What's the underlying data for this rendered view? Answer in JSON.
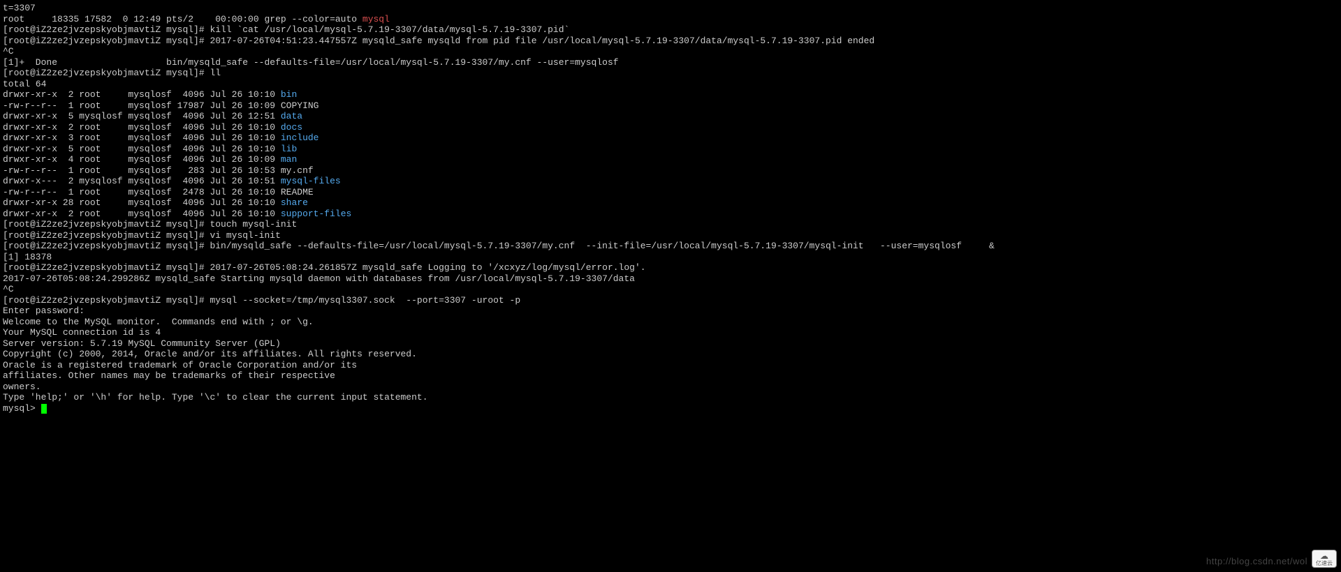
{
  "lines": [
    {
      "segments": [
        {
          "t": "t=3307",
          "c": "white"
        }
      ]
    },
    {
      "segments": [
        {
          "t": "root     18335 17582  0 12:49 pts/2    00:00:00 grep --color=auto ",
          "c": "white"
        },
        {
          "t": "mysql",
          "c": "red"
        }
      ]
    },
    {
      "segments": [
        {
          "t": "[root@iZ2ze2jvzepskyobjmavtiZ mysql]# kill `cat /usr/local/mysql-5.7.19-3307/data/mysql-5.7.19-3307.pid`",
          "c": "white"
        }
      ]
    },
    {
      "segments": [
        {
          "t": "[root@iZ2ze2jvzepskyobjmavtiZ mysql]# 2017-07-26T04:51:23.447557Z mysqld_safe mysqld from pid file /usr/local/mysql-5.7.19-3307/data/mysql-5.7.19-3307.pid ended",
          "c": "white"
        }
      ]
    },
    {
      "segments": [
        {
          "t": "^C",
          "c": "white"
        }
      ]
    },
    {
      "segments": [
        {
          "t": "[1]+  Done                    bin/mysqld_safe --defaults-file=/usr/local/mysql-5.7.19-3307/my.cnf --user=mysqlosf",
          "c": "white"
        }
      ]
    },
    {
      "segments": [
        {
          "t": "[root@iZ2ze2jvzepskyobjmavtiZ mysql]# ll",
          "c": "white"
        }
      ]
    },
    {
      "segments": [
        {
          "t": "total 64",
          "c": "white"
        }
      ]
    },
    {
      "segments": [
        {
          "t": "drwxr-xr-x  2 root     mysqlosf  4096 Jul 26 10:10 ",
          "c": "white"
        },
        {
          "t": "bin",
          "c": "cyan"
        }
      ]
    },
    {
      "segments": [
        {
          "t": "-rw-r--r--  1 root     mysqlosf 17987 Jul 26 10:09 COPYING",
          "c": "white"
        }
      ]
    },
    {
      "segments": [
        {
          "t": "drwxr-xr-x  5 mysqlosf mysqlosf  4096 Jul 26 12:51 ",
          "c": "white"
        },
        {
          "t": "data",
          "c": "cyan"
        }
      ]
    },
    {
      "segments": [
        {
          "t": "drwxr-xr-x  2 root     mysqlosf  4096 Jul 26 10:10 ",
          "c": "white"
        },
        {
          "t": "docs",
          "c": "cyan"
        }
      ]
    },
    {
      "segments": [
        {
          "t": "drwxr-xr-x  3 root     mysqlosf  4096 Jul 26 10:10 ",
          "c": "white"
        },
        {
          "t": "include",
          "c": "cyan"
        }
      ]
    },
    {
      "segments": [
        {
          "t": "drwxr-xr-x  5 root     mysqlosf  4096 Jul 26 10:10 ",
          "c": "white"
        },
        {
          "t": "lib",
          "c": "cyan"
        }
      ]
    },
    {
      "segments": [
        {
          "t": "drwxr-xr-x  4 root     mysqlosf  4096 Jul 26 10:09 ",
          "c": "white"
        },
        {
          "t": "man",
          "c": "cyan"
        }
      ]
    },
    {
      "segments": [
        {
          "t": "-rw-r--r--  1 root     mysqlosf   283 Jul 26 10:53 my.cnf",
          "c": "white"
        }
      ]
    },
    {
      "segments": [
        {
          "t": "drwxr-x---  2 mysqlosf mysqlosf  4096 Jul 26 10:51 ",
          "c": "white"
        },
        {
          "t": "mysql-files",
          "c": "cyan"
        }
      ]
    },
    {
      "segments": [
        {
          "t": "-rw-r--r--  1 root     mysqlosf  2478 Jul 26 10:10 README",
          "c": "white"
        }
      ]
    },
    {
      "segments": [
        {
          "t": "drwxr-xr-x 28 root     mysqlosf  4096 Jul 26 10:10 ",
          "c": "white"
        },
        {
          "t": "share",
          "c": "cyan"
        }
      ]
    },
    {
      "segments": [
        {
          "t": "drwxr-xr-x  2 root     mysqlosf  4096 Jul 26 10:10 ",
          "c": "white"
        },
        {
          "t": "support-files",
          "c": "cyan"
        }
      ]
    },
    {
      "segments": [
        {
          "t": "[root@iZ2ze2jvzepskyobjmavtiZ mysql]# touch mysql-init",
          "c": "white"
        }
      ]
    },
    {
      "segments": [
        {
          "t": "[root@iZ2ze2jvzepskyobjmavtiZ mysql]# vi mysql-init",
          "c": "white"
        }
      ]
    },
    {
      "segments": [
        {
          "t": "[root@iZ2ze2jvzepskyobjmavtiZ mysql]# bin/mysqld_safe --defaults-file=/usr/local/mysql-5.7.19-3307/my.cnf  --init-file=/usr/local/mysql-5.7.19-3307/mysql-init   --user=mysqlosf     &",
          "c": "white"
        }
      ]
    },
    {
      "segments": [
        {
          "t": "[1] 18378",
          "c": "white"
        }
      ]
    },
    {
      "segments": [
        {
          "t": "[root@iZ2ze2jvzepskyobjmavtiZ mysql]# 2017-07-26T05:08:24.261857Z mysqld_safe Logging to '/xcxyz/log/mysql/error.log'.",
          "c": "white"
        }
      ]
    },
    {
      "segments": [
        {
          "t": "2017-07-26T05:08:24.299286Z mysqld_safe Starting mysqld daemon with databases from /usr/local/mysql-5.7.19-3307/data",
          "c": "white"
        }
      ]
    },
    {
      "segments": [
        {
          "t": "^C",
          "c": "white"
        }
      ]
    },
    {
      "segments": [
        {
          "t": "[root@iZ2ze2jvzepskyobjmavtiZ mysql]# mysql --socket=/tmp/mysql3307.sock  --port=3307 -uroot -p",
          "c": "white"
        }
      ]
    },
    {
      "segments": [
        {
          "t": "Enter password:",
          "c": "white"
        }
      ]
    },
    {
      "segments": [
        {
          "t": "Welcome to the MySQL monitor.  Commands end with ; or \\g.",
          "c": "white"
        }
      ]
    },
    {
      "segments": [
        {
          "t": "Your MySQL connection id is 4",
          "c": "white"
        }
      ]
    },
    {
      "segments": [
        {
          "t": "Server version: 5.7.19 MySQL Community Server (GPL)",
          "c": "white"
        }
      ]
    },
    {
      "segments": [
        {
          "t": "",
          "c": "white"
        }
      ]
    },
    {
      "segments": [
        {
          "t": "Copyright (c) 2000, 2014, Oracle and/or its affiliates. All rights reserved.",
          "c": "white"
        }
      ]
    },
    {
      "segments": [
        {
          "t": "",
          "c": "white"
        }
      ]
    },
    {
      "segments": [
        {
          "t": "Oracle is a registered trademark of Oracle Corporation and/or its",
          "c": "white"
        }
      ]
    },
    {
      "segments": [
        {
          "t": "affiliates. Other names may be trademarks of their respective",
          "c": "white"
        }
      ]
    },
    {
      "segments": [
        {
          "t": "owners.",
          "c": "white"
        }
      ]
    },
    {
      "segments": [
        {
          "t": "",
          "c": "white"
        }
      ]
    },
    {
      "segments": [
        {
          "t": "Type 'help;' or '\\h' for help. Type '\\c' to clear the current input statement.",
          "c": "white"
        }
      ]
    },
    {
      "segments": [
        {
          "t": "",
          "c": "white"
        }
      ]
    },
    {
      "segments": [
        {
          "t": "mysql> ",
          "c": "white"
        }
      ],
      "cursor": true
    }
  ],
  "watermark": "http://blog.csdn.net/wol",
  "badge_text": "亿速云"
}
